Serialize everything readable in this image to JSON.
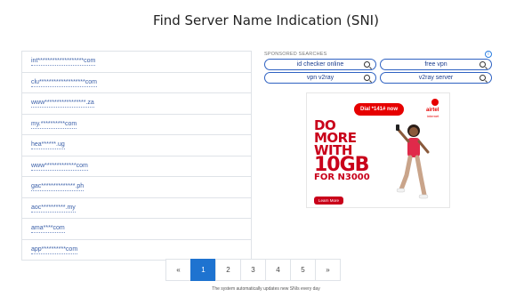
{
  "page": {
    "title": "Find Server Name Indication (SNI)"
  },
  "sni_list": [
    "int*******************com",
    "clu*******************com",
    "www*****************.za",
    "my.**********com",
    "hea******.ug",
    "www*************com",
    "gac**************.ph",
    "aoc**********.my",
    "ama****com",
    "app**********com"
  ],
  "sponsored": {
    "header": "SPONSORED SEARCHES",
    "info_icon": "info-icon",
    "chips": [
      "id checker online",
      "free vpn",
      "vpn v2ray",
      "v2ray server"
    ]
  },
  "ad": {
    "dial": "Dial *141# now",
    "brand": "airtel",
    "brand_sub": "internet",
    "headline": [
      "DO",
      "MORE",
      "WITH"
    ],
    "big": "10GB",
    "sub": "FOR N3000",
    "cta": "Learn More",
    "brand_color": "#e60000"
  },
  "pagination": {
    "prev": "«",
    "pages": [
      "1",
      "2",
      "3",
      "4",
      "5"
    ],
    "next": "»",
    "active": "1",
    "active_color": "#1e73d0"
  },
  "footer": {
    "note": "The system automatically updates new SNIs every day"
  }
}
